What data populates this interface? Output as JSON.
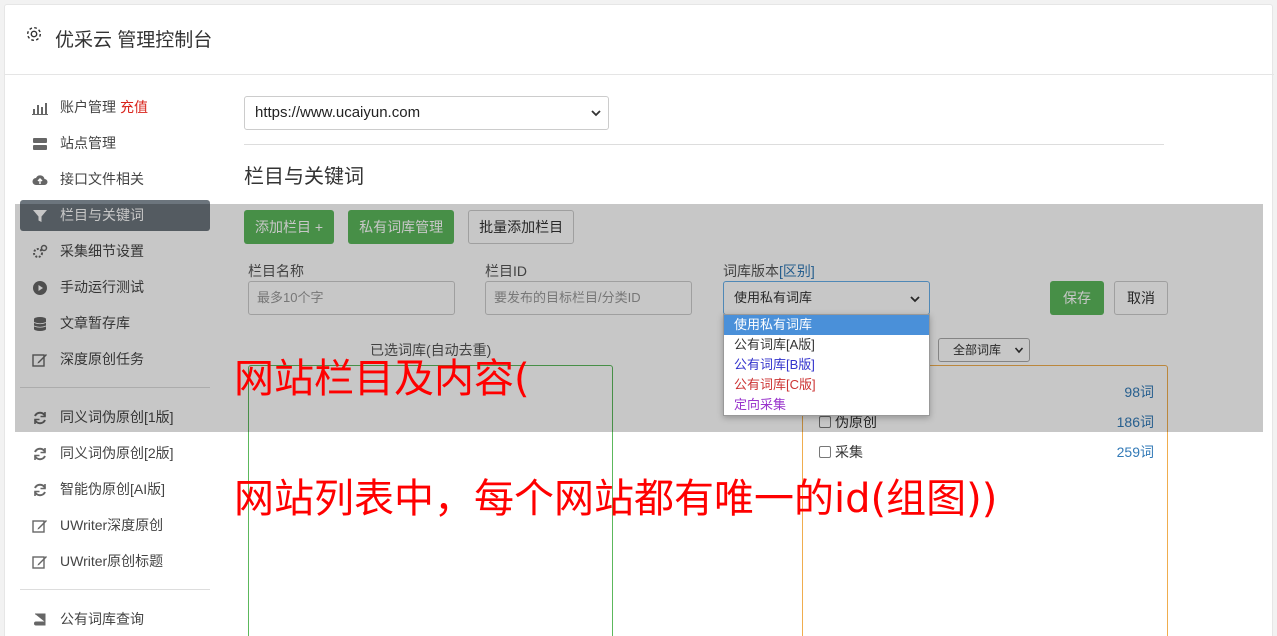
{
  "header": {
    "title": "优采云 管理控制台",
    "icon": "gear-icon"
  },
  "sidebar": {
    "items": [
      {
        "label": "账户管理",
        "extra": "充值",
        "icon": "bar-chart-icon"
      },
      {
        "label": "站点管理",
        "icon": "server-icon"
      },
      {
        "label": "接口文件相关",
        "icon": "cloud-upload-icon"
      },
      {
        "label": "栏目与关键词",
        "icon": "filter-icon",
        "active": true
      },
      {
        "label": "采集细节设置",
        "icon": "cogs-icon"
      },
      {
        "label": "手动运行测试",
        "icon": "play-circle-icon"
      },
      {
        "label": "文章暂存库",
        "icon": "database-icon"
      },
      {
        "label": "深度原创任务",
        "icon": "edit-icon"
      }
    ],
    "items2": [
      {
        "label": "同义词伪原创[1版]",
        "icon": "refresh-icon"
      },
      {
        "label": "同义词伪原创[2版]",
        "icon": "refresh-icon"
      },
      {
        "label": "智能伪原创[AI版]",
        "icon": "refresh-icon"
      },
      {
        "label": "UWriter深度原创",
        "icon": "edit-icon"
      },
      {
        "label": "UWriter原创标题",
        "icon": "edit-icon"
      }
    ],
    "items3": [
      {
        "label": "公有词库查询",
        "icon": "book-icon"
      }
    ]
  },
  "main": {
    "site_select": {
      "value": "https://www.ucaiyun.com"
    },
    "section_title": "栏目与关键词",
    "toolbar": {
      "add_column": "添加栏目 +",
      "private_lib": "私有词库管理",
      "batch_add": "批量添加栏目"
    },
    "form": {
      "name_label": "栏目名称",
      "name_placeholder": "最多10个字",
      "id_label": "栏目ID",
      "id_placeholder": "要发布的目标栏目/分类ID",
      "version_label": "词库版本",
      "version_link": "[区别]",
      "version_value": "使用私有词库",
      "save": "保存",
      "cancel": "取消"
    },
    "version_options": [
      {
        "label": "使用私有词库",
        "color": "#ffffff",
        "selected": true
      },
      {
        "label": "公有词库[A版]",
        "color": "#333333"
      },
      {
        "label": "公有词库[B版]",
        "color": "#3333cc"
      },
      {
        "label": "公有词库[C版]",
        "color": "#cc3333"
      },
      {
        "label": "定向采集",
        "color": "#9933cc"
      }
    ],
    "selected_box_label": "已选词库(自动去重)",
    "lib_filter": "全部词库",
    "libs": [
      {
        "name": "",
        "count": "98词"
      },
      {
        "name": "伪原创",
        "count": "186词"
      },
      {
        "name": "采集",
        "count": "259词"
      }
    ]
  },
  "annotations": {
    "line1": "网站栏目及内容(",
    "line2": "网站列表中，每个网站都有唯一的id(组图))"
  }
}
